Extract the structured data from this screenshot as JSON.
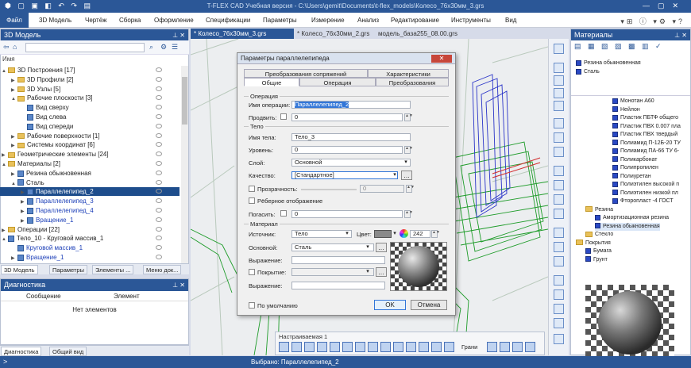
{
  "window": {
    "title": "T-FLEX CAD Учебная версия - C:\\Users\\gemit\\Documents\\t-flex_models\\Колесо_76x30мм_3.grs"
  },
  "menu": {
    "file": "Файл",
    "items": [
      "3D Модель",
      "Чертёж",
      "Сборка",
      "Оформление",
      "Спецификации",
      "Параметры",
      "Измерение",
      "Анализ",
      "Редактирование",
      "Инструменты",
      "Вид"
    ]
  },
  "left_panel": {
    "title": "3D Модель",
    "column_header": "Имя",
    "tree": [
      {
        "label": "3D Построения [17]",
        "indent": 1,
        "icon": "folder",
        "expander": "▲"
      },
      {
        "label": "3D Профили [2]",
        "indent": 2,
        "icon": "folder",
        "expander": "▶"
      },
      {
        "label": "3D Узлы [5]",
        "indent": 2,
        "icon": "folder",
        "expander": "▶"
      },
      {
        "label": "Рабочие плоскости [3]",
        "indent": 2,
        "icon": "folder",
        "expander": "▲"
      },
      {
        "label": "Вид сверху",
        "indent": 3,
        "icon": "plane",
        "expander": ""
      },
      {
        "label": "Вид слева",
        "indent": 3,
        "icon": "plane",
        "expander": ""
      },
      {
        "label": "Вид спереди",
        "indent": 3,
        "icon": "plane",
        "expander": ""
      },
      {
        "label": "Рабочие поверхности [1]",
        "indent": 2,
        "icon": "folder",
        "expander": "▶"
      },
      {
        "label": "Системы координат [6]",
        "indent": 2,
        "icon": "folder",
        "expander": "▶"
      },
      {
        "label": "Геометрические элементы [24]",
        "indent": 1,
        "icon": "folder",
        "expander": "▶"
      },
      {
        "label": "Материалы [2]",
        "indent": 1,
        "icon": "folder",
        "expander": "▲"
      },
      {
        "label": "Резина обыкновенная",
        "indent": 2,
        "icon": "body",
        "expander": "▶"
      },
      {
        "label": "Сталь",
        "indent": 2,
        "icon": "body",
        "expander": "▲"
      },
      {
        "label": "Параллелепипед_2",
        "indent": 3,
        "icon": "body",
        "expander": "▶",
        "selected": true
      },
      {
        "label": "Параллелепипед_3",
        "indent": 3,
        "icon": "body",
        "expander": "▶",
        "link": true
      },
      {
        "label": "Параллелепипед_4",
        "indent": 3,
        "icon": "body",
        "expander": "▶",
        "link": true
      },
      {
        "label": "Вращение_1",
        "indent": 3,
        "icon": "body",
        "expander": "▶",
        "link": true
      },
      {
        "label": "Операции [22]",
        "indent": 1,
        "icon": "folder",
        "expander": "▶"
      },
      {
        "label": "Тело_10 - Круговой массив_1",
        "indent": 1,
        "icon": "body",
        "expander": "▲"
      },
      {
        "label": "Круговой массив_1",
        "indent": 2,
        "icon": "body",
        "expander": "",
        "link": true
      },
      {
        "label": "Вращение_1",
        "indent": 2,
        "icon": "body",
        "expander": "▶",
        "link": true
      }
    ],
    "tabs": [
      "3D Модель",
      "Параметры",
      "Элементы ...",
      "Меню док..."
    ]
  },
  "diagnostics": {
    "title": "Диагностика",
    "col1": "Сообщение",
    "col2": "Элемент",
    "empty": "Нет элементов",
    "tabs": [
      "Диагностика",
      "Общий вид"
    ]
  },
  "doc_tabs": [
    "* Колесо_76x30мм_3.grs",
    "* Колесо_76x30мм_2.grs",
    "модель_база255_08.00.grs"
  ],
  "dialog": {
    "title": "Параметры параллелепипеда",
    "tabs_row1": [
      "Преобразования сопряжений",
      "Характеристики"
    ],
    "tabs_row2": [
      "Общие",
      "Операция",
      "Преобразования"
    ],
    "group_operation": "Операция",
    "op_name_label": "Имя операции:",
    "op_name_value": "Параллелепипед_2",
    "move_label": "Продвить:",
    "move_value": "0",
    "group_body": "Тело",
    "body_name_label": "Имя тела:",
    "body_name_value": "Тело_3",
    "level_label": "Уровень:",
    "level_value": "0",
    "layer_label": "Слой:",
    "layer_value": "Основной",
    "quality_label": "Качество:",
    "quality_value": "[Стандартное]",
    "transparency_label": "Прозрачность:",
    "transparency_value": "0",
    "edge_label": "Рёберное отображение",
    "hide_label": "Погасить:",
    "hide_value": "0",
    "group_material": "Материал",
    "source_label": "Источник:",
    "source_value": "Тело",
    "color_label": "Цвет:",
    "color_value": "242",
    "main_label": "Основной:",
    "main_value": "Сталь",
    "expr_label1": "Выражение:",
    "cover_label": "Покрытие:",
    "expr_label2": "Выражение:",
    "default_label": "По умолчанию",
    "ok": "OK",
    "cancel": "Отмена"
  },
  "materials_panel": {
    "title": "Материалы",
    "used": [
      "Резина обыкновенная",
      "Сталь"
    ],
    "items": [
      "Монотан А60",
      "Нейлон",
      "Пластик ПБТФ общего",
      "Пластик ПВХ 0.007 пла",
      "Пластик ПВХ твердый",
      "Полиамид П-12Б-20 ТУ",
      "Полиамид ПА-66 ТУ 6-",
      "Поликарбонат",
      "Полипропилен",
      "Полиуретан",
      "Полиэтилен высокой п",
      "Полиэтилен низкой пл",
      "Фторопласт -4 ГОСТ"
    ],
    "group_rubber": "Резина",
    "rubber_items": [
      "Амортизационная резина",
      "Резина обыкновенная"
    ],
    "group_glass": "Стекло",
    "group_coatings": "Покрытия",
    "coating_items": [
      "Бумага",
      "Грунт"
    ]
  },
  "toolbar_float": {
    "title": "Настраиваемая 1",
    "edges_label": "Грани"
  },
  "status": {
    "text": "Выбрано: Параллелепипед_2"
  }
}
